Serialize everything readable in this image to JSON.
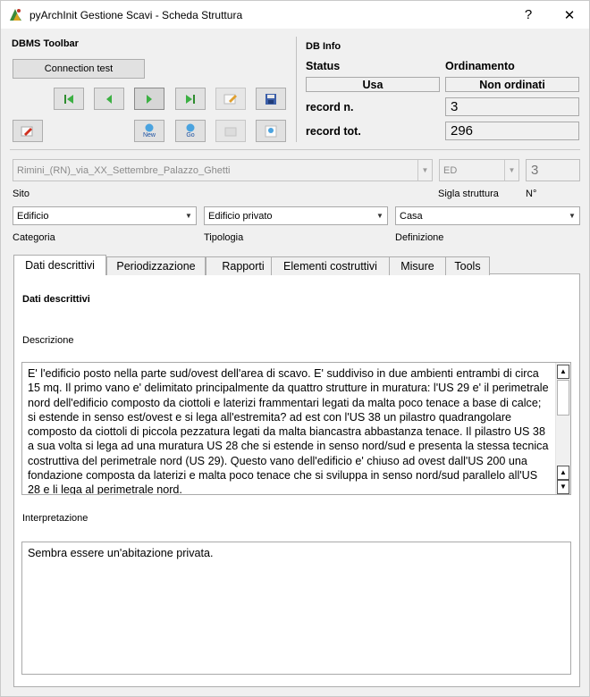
{
  "window": {
    "title": "pyArchInit Gestione Scavi - Scheda Struttura",
    "help_glyph": "?",
    "close_glyph": "✕"
  },
  "dbms": {
    "title": "DBMS Toolbar",
    "connection_button": "Connection test",
    "nav_icons": [
      "first-record-icon",
      "previous-record-icon",
      "next-record-icon",
      "last-record-icon",
      "edit-icon",
      "save-icon"
    ],
    "new_label": "New",
    "go_label": "Go"
  },
  "dbinfo": {
    "title": "DB Info",
    "status_label": "Status",
    "status_value": "Usa",
    "order_label": "Ordinamento",
    "order_value": "Non ordinati",
    "record_n_label": "record n.",
    "record_n_value": "3",
    "record_tot_label": "record tot.",
    "record_tot_value": "296"
  },
  "fields": {
    "sito_value": "Rimini_(RN)_via_XX_Settembre_Palazzo_Ghetti",
    "sito_label": "Sito",
    "sigla_value": "ED",
    "sigla_label": "Sigla struttura",
    "numero_value": "3",
    "numero_label": "N°",
    "categoria_value": "Edificio",
    "categoria_label": "Categoria",
    "tipologia_value": "Edificio privato",
    "tipologia_label": "Tipologia",
    "definizione_value": "Casa",
    "definizione_label": "Definizione"
  },
  "tabs": [
    "Dati descrittivi",
    "Periodizzazione",
    "Rapporti",
    "Elementi costruttivi",
    "Misure",
    "Tools"
  ],
  "panel": {
    "heading": "Dati descrittivi",
    "descrizione_label": "Descrizione",
    "descrizione_text": "E' l'edificio posto nella parte sud/ovest dell'area di scavo. E' suddiviso in due ambienti entrambi di circa 15 mq. Il primo vano e' delimitato principalmente da quattro strutture in muratura: l'US 29 e' il perimetrale nord dell'edificio composto da ciottoli e laterizi frammentari legati da malta poco tenace a base di calce; si estende in senso est/ovest e si lega all'estremita? ad est con l'US 38 un pilastro quadrangolare composto da ciottoli di piccola pezzatura legati da malta biancastra abbastanza tenace. Il pilastro US 38 a sua volta si lega ad una muratura US 28 che si estende in senso nord/sud e presenta la stessa tecnica costruttiva del perimetrale nord (US 29). Questo vano dell'edificio e' chiuso ad ovest dall'US 200 una fondazione composta da laterizi e malta poco tenace che si sviluppa in senso nord/sud parallelo all'US 28 e li lega al perimetrale nord.",
    "interpretazione_label": "Interpretazione",
    "interpretazione_text": "Sembra essere un'abitazione privata."
  }
}
